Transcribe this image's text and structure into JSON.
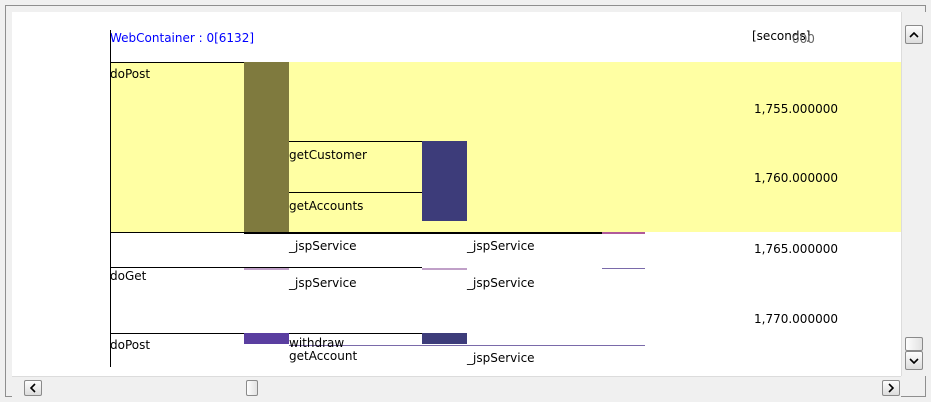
{
  "container_label": "WebContainer : 0[6132]",
  "time_axis": {
    "unit_label": "[seconds]",
    "unit_overlap_text": "",
    "ticks": [
      "1,750.000000",
      "1,755.000000",
      "1,760.000000",
      "1,765.000000",
      "1,770.000000"
    ]
  },
  "calls": [
    {
      "label": "doPost"
    },
    {
      "label": "getCustomer"
    },
    {
      "label": "getAccounts"
    },
    {
      "label": "_jspService"
    },
    {
      "label": "_jspService"
    },
    {
      "label": "doGet"
    },
    {
      "label": "_jspService"
    },
    {
      "label": "_jspService"
    },
    {
      "label": "doPost"
    },
    {
      "label": "withdraw"
    },
    {
      "label": "getAccount"
    },
    {
      "label": "_jspService"
    }
  ],
  "colors": {
    "highlight": "#ffff99",
    "bar_olive": "#7f7a3e",
    "bar_navy": "#3d3c7a",
    "bar_purple": "#5a3ea0",
    "bar_pink": "#c0a0c8",
    "link_blue": "#0000ff"
  },
  "scrollbars": {
    "up_icon": "chevron-up-icon",
    "down_icon": "chevron-down-icon",
    "left_icon": "chevron-left-icon",
    "right_icon": "chevron-right-icon"
  }
}
